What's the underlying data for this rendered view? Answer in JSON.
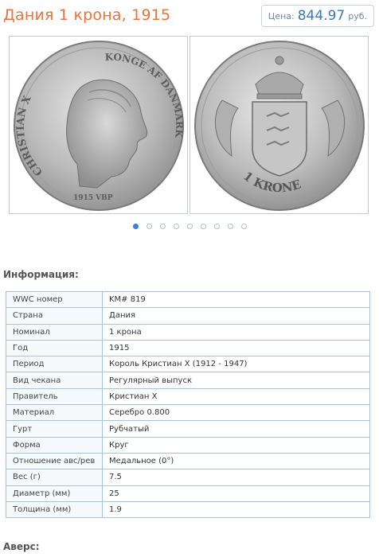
{
  "title": "Дания 1 крона, 1915",
  "price": {
    "label": "Цена:",
    "value": "844.97",
    "currency": "руб."
  },
  "coin": {
    "obverse_legend_left": "CHRISTIAN X",
    "obverse_legend_right": "KONGE AF DANMARK",
    "obverse_bottom": "1915 VBP",
    "reverse_legend": "1 KRONE"
  },
  "gallery": {
    "count": 9,
    "active_index": 0
  },
  "info": {
    "heading": "Информация:",
    "rows": [
      {
        "key": "WWC номер",
        "value": "KM# 819"
      },
      {
        "key": "Страна",
        "value": "Дания"
      },
      {
        "key": "Номинал",
        "value": "1 крона"
      },
      {
        "key": "Год",
        "value": "1915"
      },
      {
        "key": "Период",
        "value": "Король Кристиан X (1912 - 1947)"
      },
      {
        "key": "Вид чекана",
        "value": "Регулярный выпуск"
      },
      {
        "key": "Правитель",
        "value": "Кристиан X"
      },
      {
        "key": "Материал",
        "value": "Серебро 0.800"
      },
      {
        "key": "Гурт",
        "value": "Рубчатый"
      },
      {
        "key": "Форма",
        "value": "Круг"
      },
      {
        "key": "Отношение авс/рев",
        "value": "Медальное (0°)"
      },
      {
        "key": "Вес (г)",
        "value": "7.5"
      },
      {
        "key": "Диаметр (мм)",
        "value": "25"
      },
      {
        "key": "Толщина (мм)",
        "value": "1.9"
      }
    ]
  },
  "obverse": {
    "heading": "Аверс:"
  }
}
